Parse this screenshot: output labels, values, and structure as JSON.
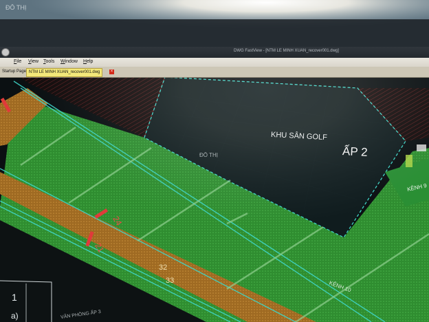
{
  "window": {
    "title": "DWG FastView - [NTM LE MINH XUAN_recover001.dwg]"
  },
  "menu": [
    {
      "label": "File"
    },
    {
      "label": "View"
    },
    {
      "label": "Tools"
    },
    {
      "label": "Window"
    },
    {
      "label": "Help"
    }
  ],
  "tabs": [
    {
      "label": "Startup Page",
      "active": false
    },
    {
      "label": "NTM LE MINH XUAN_recover001.dwg",
      "active": true
    }
  ],
  "drawing_labels": {
    "do_thi_top": "ĐÔ THỊ",
    "do_thi_mid": "ĐÔ THỊ",
    "golf": "KHU SÂN GOLF",
    "ap2": "ẤP 2",
    "kenh9": "KÊNH 9",
    "kenh10": "KÊNH 10",
    "num24": "24",
    "num21": "21",
    "num32": "32",
    "num33": "33",
    "num1": "1",
    "bottom_a": "a)",
    "bottom_text": "VĂN PHÒNG ẤP 3"
  },
  "colors": {
    "field_green": "#2e8a2e",
    "golf_area": "#101a1c",
    "road_band_orange": "#a86d24",
    "boundary_cyan": "#3fd6c8",
    "parcel_red": "#d23a3a"
  }
}
